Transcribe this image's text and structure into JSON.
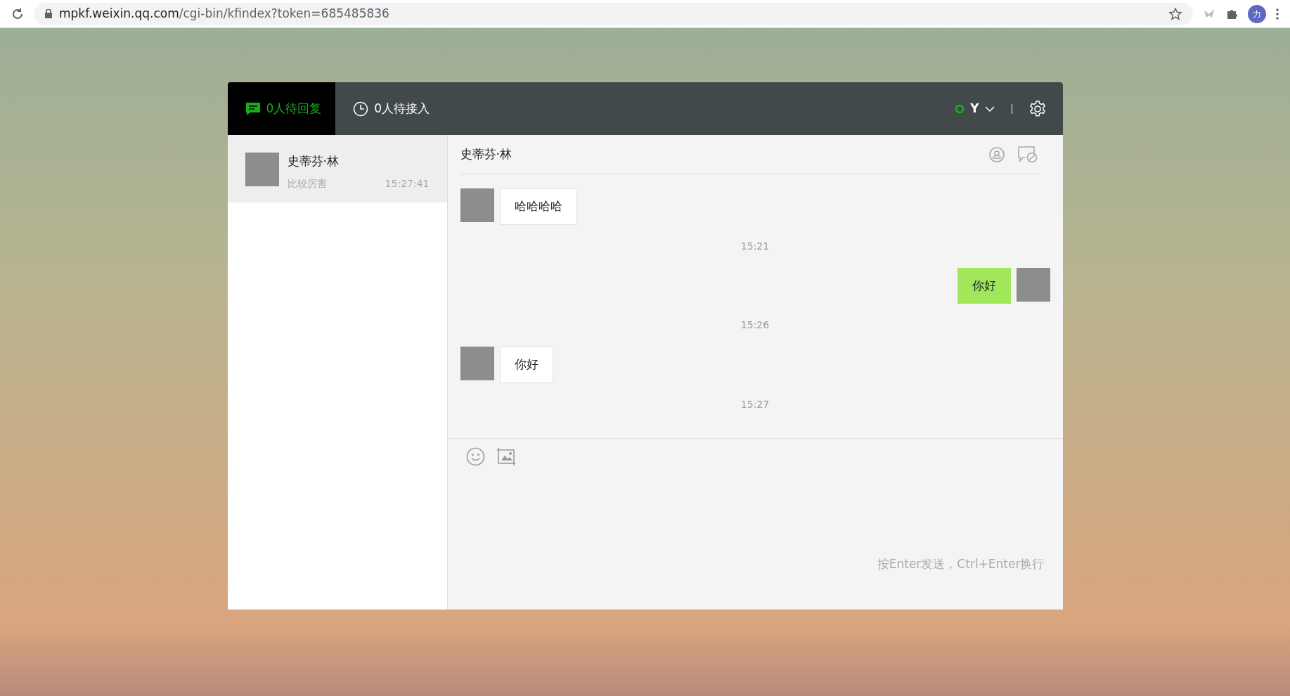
{
  "browser": {
    "url_host": "mpkf.weixin.qq.com",
    "url_path": "/cgi-bin/kfindex?token=685485836",
    "profile_initial": "力"
  },
  "tabs": [
    {
      "label": "0人待回复",
      "kind": "reply",
      "selected": true
    },
    {
      "label": "0人待接入",
      "kind": "queue",
      "selected": false
    }
  ],
  "agent": {
    "name": "Y",
    "online": true
  },
  "sessions": [
    {
      "name": "史蒂芬·林",
      "preview": "比较厉害",
      "time": "15:27:41",
      "selected": true
    }
  ],
  "chat": {
    "title": "史蒂芬·林",
    "messages": [
      {
        "kind": "incoming",
        "text": "哈哈哈哈"
      },
      {
        "kind": "time",
        "text": "15:21"
      },
      {
        "kind": "outgoing",
        "text": "你好"
      },
      {
        "kind": "time",
        "text": "15:26"
      },
      {
        "kind": "incoming",
        "text": "你好"
      },
      {
        "kind": "time",
        "text": "15:27"
      }
    ],
    "hint": "按Enter发送，Ctrl+Enter换行"
  }
}
